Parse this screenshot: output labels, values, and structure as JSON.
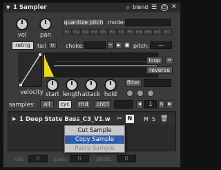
{
  "title": "1 Sampler",
  "blend_label": "blend",
  "vol_label": "vol",
  "pan_label": "pan",
  "quantize_label": "quantize pitch",
  "mode_label": "mode:",
  "intervals": [
    "RT",
    "m2",
    "M2",
    "m3",
    "M3",
    "P4",
    "TT",
    "P5",
    "m6",
    "M6",
    "m7",
    "M7"
  ],
  "retrig_label": "retrig",
  "tail_label": "tail",
  "choke_label": "choke:",
  "pitch_label": "pitch:",
  "pitch_value": "—",
  "loop_label": "loop",
  "reverse_label": "reverse",
  "filter_label": "filter",
  "velocity_label": "velocity",
  "start_label": "start",
  "length_label": "length",
  "attack_label": "attack",
  "hold_label": "hold",
  "samples_label": "samples:",
  "sample_modes": [
    "all",
    "cyc",
    "rnd",
    "cntrl"
  ],
  "sample_index": "1",
  "sample_name": "1 Deep State Bass_C3_V1.w",
  "n_label": "N",
  "m_label": "M",
  "s_label": "S",
  "context_menu": {
    "cut": "Cut Sample",
    "copy": "Copy Sample",
    "paste": "Paste Sample"
  },
  "bottom": {
    "vol_label": "vol:",
    "vol_value": "0",
    "pan_label": "pan:",
    "pan_value": "0",
    "pitch_label": "pitch:",
    "pitch_value": "0"
  },
  "colors": {
    "accent": "#e8dc18",
    "selected_menu": "#2f5fa8",
    "panel": "#3b3b3b"
  }
}
